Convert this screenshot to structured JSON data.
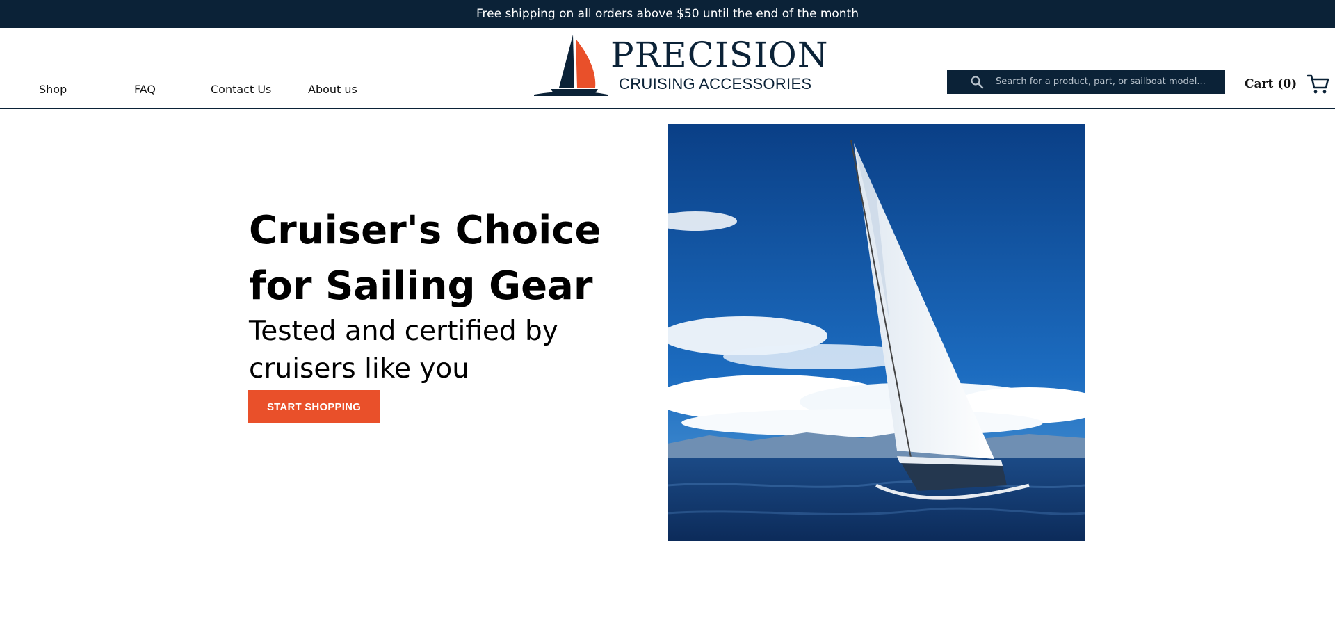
{
  "announcement": {
    "text": "Free shipping on all orders above $50 until the end of the month"
  },
  "nav": {
    "items": [
      {
        "label": "Shop"
      },
      {
        "label": "FAQ"
      },
      {
        "label": "Contact Us"
      },
      {
        "label": "About us"
      }
    ]
  },
  "logo": {
    "title": "PRECISION",
    "subtitle": "CRUISING ACCESSORIES"
  },
  "search": {
    "placeholder": "Search for a product, part, or sailboat model...",
    "icon": "search-icon"
  },
  "cart": {
    "label": "Cart (0)",
    "icon": "cart-icon"
  },
  "hero": {
    "title": "Cruiser's Choice for Sailing Gear",
    "subtitle": "Tested and certified by cruisers like you",
    "cta_label": "START SHOPPING",
    "image_subject": "sailboat-photo"
  },
  "colors": {
    "navy": "#0b2237",
    "accent": "#e9502a",
    "white": "#ffffff"
  }
}
